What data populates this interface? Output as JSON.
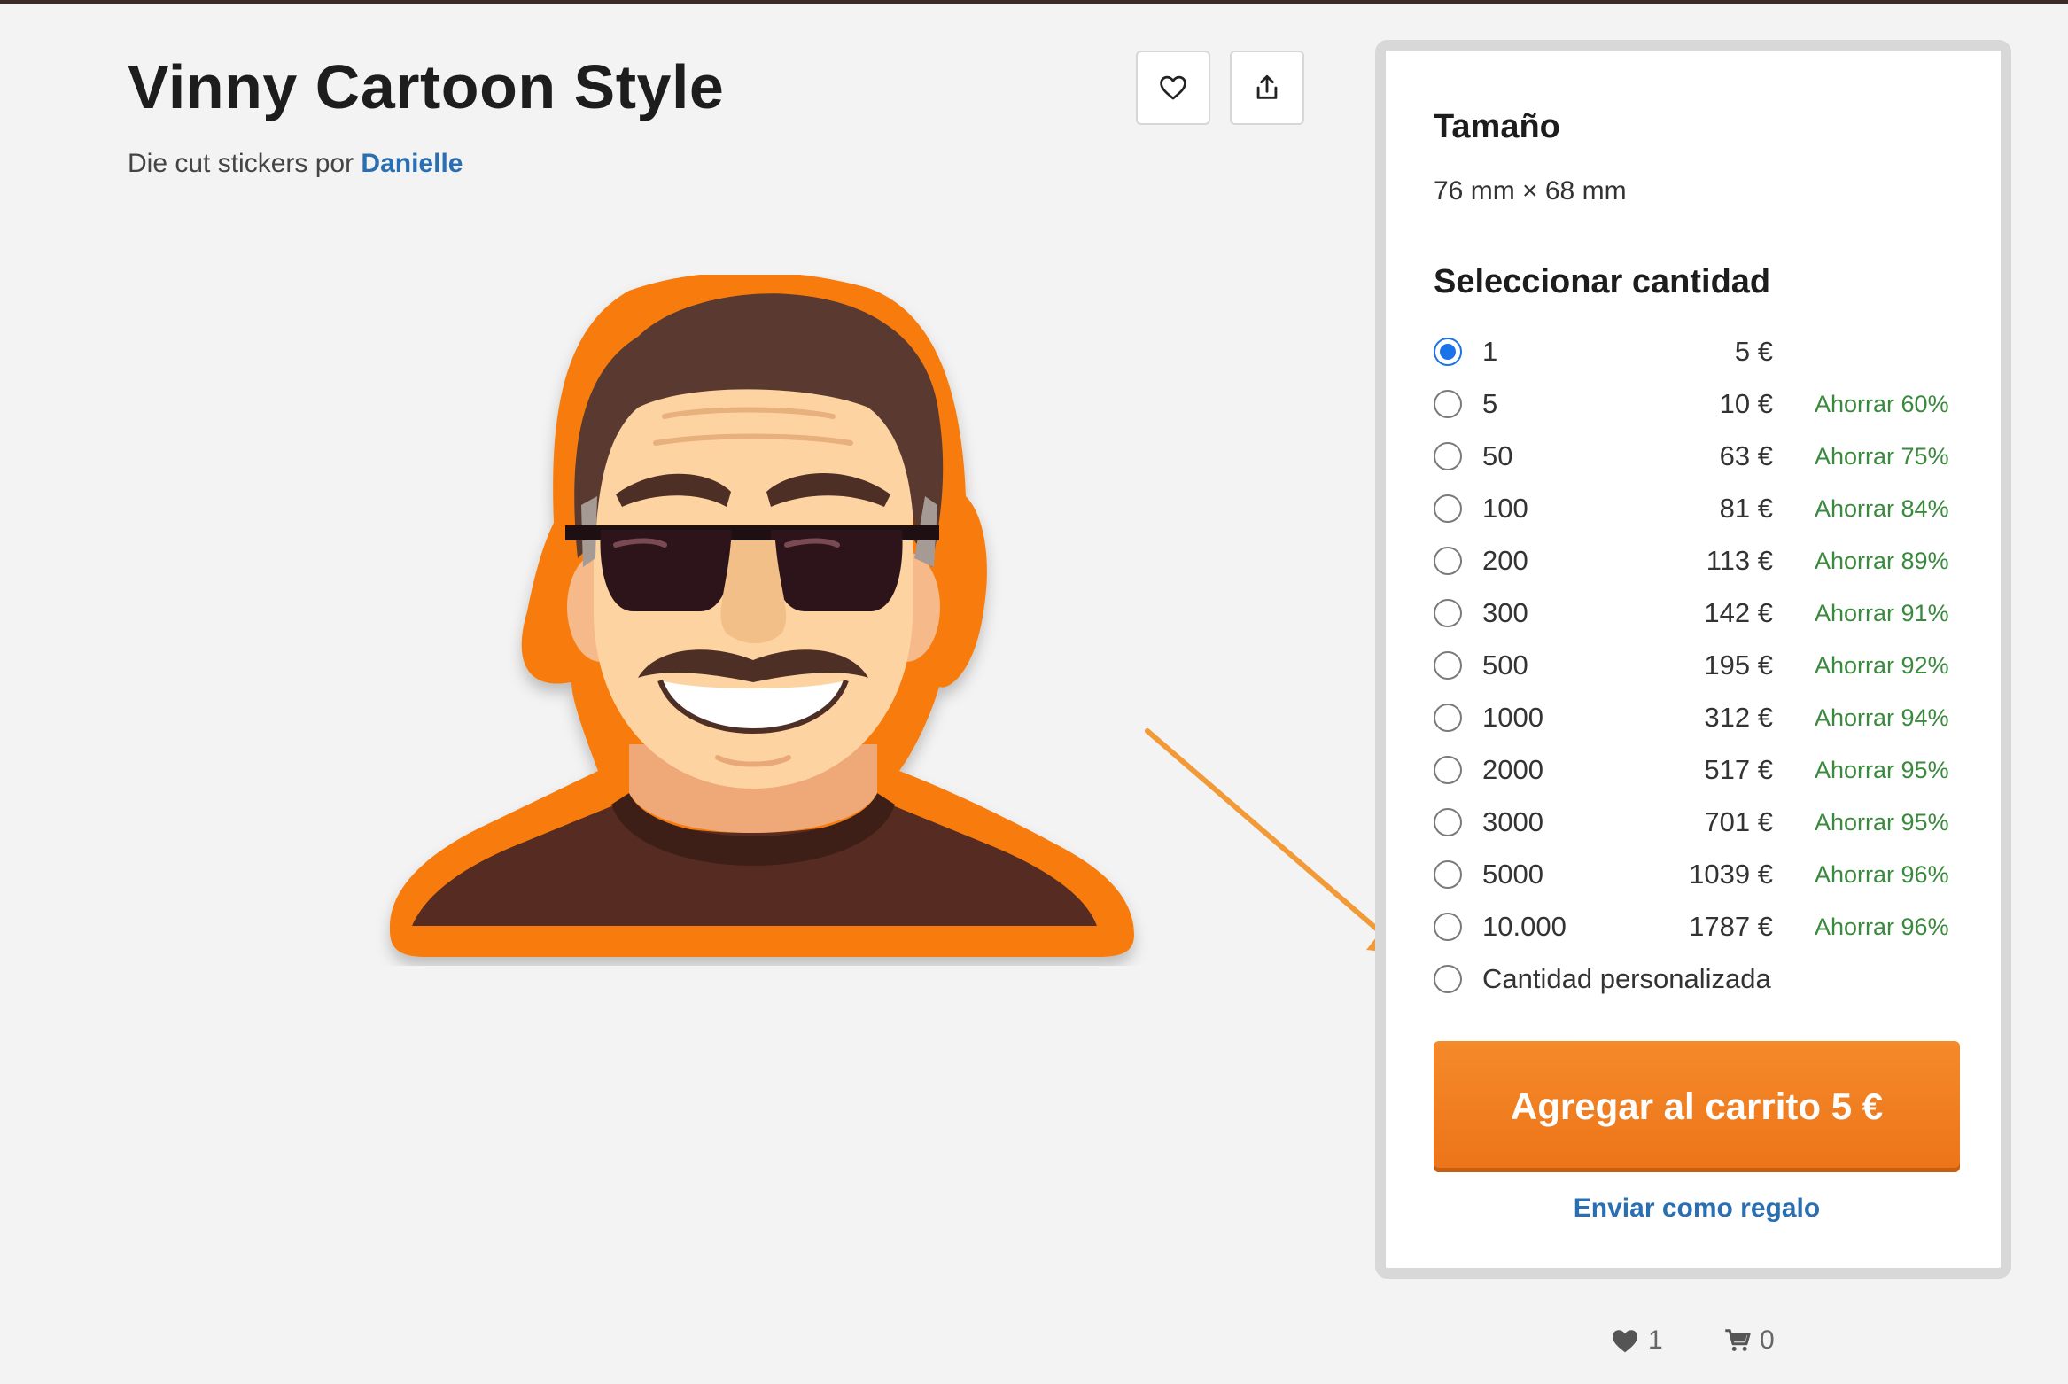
{
  "product": {
    "title": "Vinny Cartoon Style",
    "byline_prefix": "Die cut stickers por",
    "author": "Danielle"
  },
  "actions": {
    "favorite_icon": "heart-outline-icon",
    "share_icon": "share-upload-icon"
  },
  "panel": {
    "size_heading": "Tamaño",
    "size_value": "76 mm × 68 mm",
    "quantity_heading": "Seleccionar cantidad",
    "options": [
      {
        "qty": "1",
        "price": "5 €",
        "save": "",
        "checked": true
      },
      {
        "qty": "5",
        "price": "10 €",
        "save": "Ahorrar 60%",
        "checked": false
      },
      {
        "qty": "50",
        "price": "63 €",
        "save": "Ahorrar 75%",
        "checked": false
      },
      {
        "qty": "100",
        "price": "81 €",
        "save": "Ahorrar 84%",
        "checked": false
      },
      {
        "qty": "200",
        "price": "113 €",
        "save": "Ahorrar 89%",
        "checked": false
      },
      {
        "qty": "300",
        "price": "142 €",
        "save": "Ahorrar 91%",
        "checked": false
      },
      {
        "qty": "500",
        "price": "195 €",
        "save": "Ahorrar 92%",
        "checked": false
      },
      {
        "qty": "1000",
        "price": "312 €",
        "save": "Ahorrar 94%",
        "checked": false
      },
      {
        "qty": "2000",
        "price": "517 €",
        "save": "Ahorrar 95%",
        "checked": false
      },
      {
        "qty": "3000",
        "price": "701 €",
        "save": "Ahorrar 95%",
        "checked": false
      },
      {
        "qty": "5000",
        "price": "1039 €",
        "save": "Ahorrar 96%",
        "checked": false
      },
      {
        "qty": "10.000",
        "price": "1787 €",
        "save": "Ahorrar 96%",
        "checked": false
      }
    ],
    "custom_option": "Cantidad personalizada",
    "cart_button": "Agregar al carrito 5 €",
    "gift_link": "Enviar como regalo"
  },
  "stats": {
    "likes": "1",
    "cart_count": "0"
  },
  "colors": {
    "accent_orange": "#ec7418",
    "link_blue": "#2a6fb1",
    "savings_green": "#3a8a3e",
    "radio_blue": "#1a73e8"
  }
}
